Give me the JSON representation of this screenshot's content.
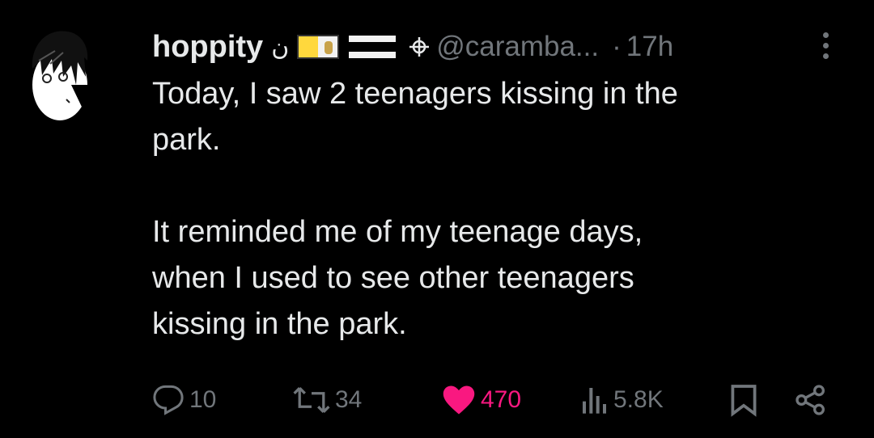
{
  "tweet": {
    "display_name": "hoppity",
    "name_glyph": "ن",
    "handle": "@caramba...",
    "separator": "·",
    "time": "17h",
    "text_paragraphs": [
      "Today, I saw 2 teenagers kissing in the\npark.",
      "It reminded me of my teenage days,\nwhen I used to see other teenagers\nkissing in the park."
    ]
  },
  "actions": {
    "replies": "10",
    "reposts": "34",
    "likes": "470",
    "views": "5.8K"
  },
  "colors": {
    "background": "#000000",
    "text": "#e7e9ea",
    "muted": "#71767b",
    "like": "#f91880"
  }
}
